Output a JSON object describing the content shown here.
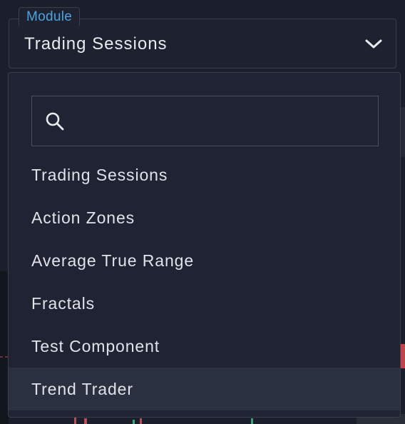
{
  "module_select": {
    "legend": "Module",
    "value": "Trading Sessions",
    "chevron_icon": "chevron-down-icon"
  },
  "search": {
    "icon": "search-icon",
    "value": "",
    "placeholder": ""
  },
  "options": [
    {
      "label": "Trading Sessions"
    },
    {
      "label": "Action Zones"
    },
    {
      "label": "Average True Range"
    },
    {
      "label": "Fractals"
    },
    {
      "label": "Test Component"
    },
    {
      "label": "Trend Trader"
    }
  ],
  "hovered_option": "Trend Trader",
  "colors": {
    "background": "#1b1f2b",
    "panel": "#1f2333",
    "border": "#3a3f4d",
    "legend_text": "#4ca3df",
    "option_text": "#e1e3e8",
    "hover": "#2b3040"
  }
}
